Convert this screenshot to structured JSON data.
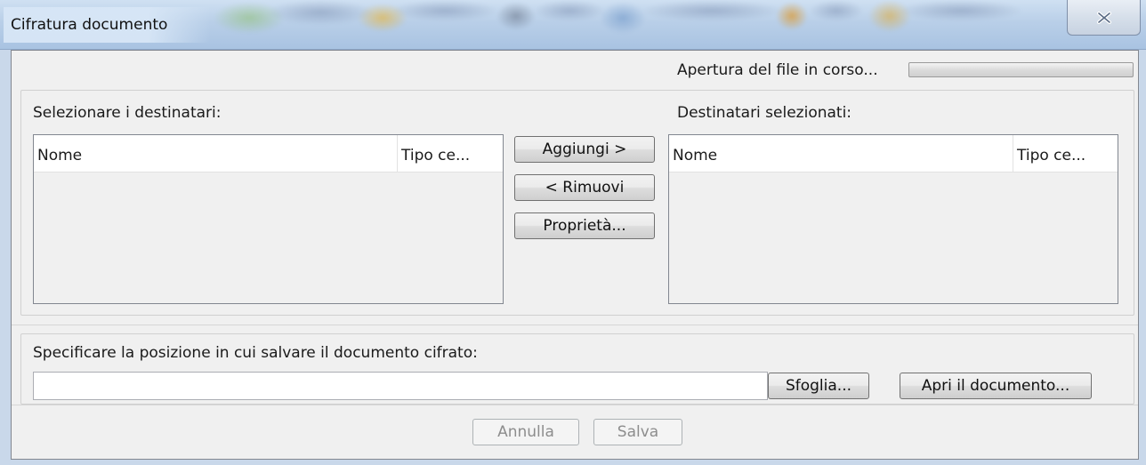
{
  "window": {
    "title": "Cifratura documento",
    "close_glyph": "close-icon"
  },
  "status": {
    "text": "Apertura del file in corso...",
    "progress": 0
  },
  "recipients": {
    "available_label": "Selezionare i destinatari:",
    "selected_label": "Destinatari selezionati:",
    "columns": [
      "Nome",
      "Tipo ce..."
    ],
    "available_items": [],
    "selected_items": []
  },
  "actions": {
    "add": "Aggiungi >",
    "remove": "< Rimuovi",
    "properties": "Proprietà..."
  },
  "save": {
    "label": "Specificare la posizione in cui salvare il documento cifrato:",
    "path_value": "",
    "browse": "Sfoglia...",
    "open_document": "Apri il documento..."
  },
  "footer": {
    "cancel": "Annulla",
    "save": "Salva"
  }
}
